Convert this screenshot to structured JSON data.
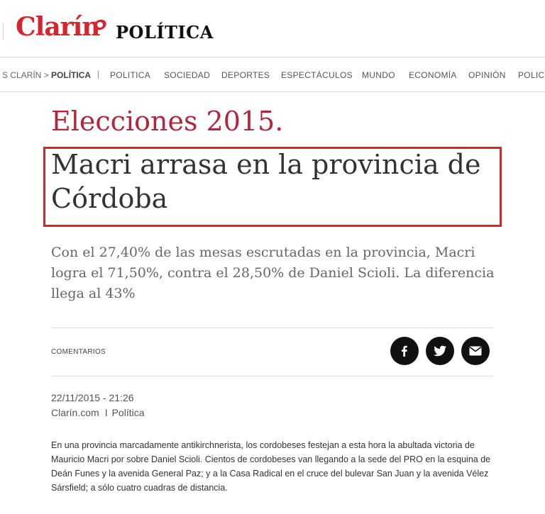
{
  "header": {
    "logo_text": "Clarín",
    "section": "POLÍTICA"
  },
  "nav": {
    "breadcrumb_site": "S CLARÍN",
    "breadcrumb_sep": " > ",
    "breadcrumb_section": "POLÍTICA",
    "divider": "|",
    "items": [
      "POLITICA",
      "SOCIEDAD",
      "DEPORTES",
      "ESPECTÁCULOS",
      "MUNDO",
      "ECONOMÍA",
      "OPINIÓN",
      "POLICI"
    ]
  },
  "article": {
    "kicker": "Elecciones 2015.",
    "headline": "Macri arrasa en la provincia de Córdoba",
    "summary": "Con el 27,40% de las mesas escrutadas en la provincia, Macri logra el 71,50%, contra el 28,50% de Daniel Scioli. La diferencia llega al 43%",
    "comments_label": "COMENTARIOS",
    "date": "22/11/2015 - 21:26",
    "source": "Clarín.com",
    "source_pipe": "I",
    "source_section": "Política",
    "body": "En una provincia marcadamente antikirchnerista, los cordobeses festejan a esta hora la abultada victoria de Mauricio Macri por sobre Daniel Scioli. Cientos de cordobeses van llegando a la sede del PRO en la esquina de Deán Funes y la avenida General Paz; y a la Casa Radical en el cruce del bulevar San Juan y la avenida Vélez Sársfield; a sólo cuatro cuadras de distancia."
  },
  "share": {
    "icons": [
      "facebook-icon",
      "twitter-icon",
      "email-icon"
    ],
    "button_color": "#111111"
  },
  "colors": {
    "brand_red": "#d6262d",
    "kicker": "#b4243a",
    "highlight_box": "#d6262d"
  }
}
